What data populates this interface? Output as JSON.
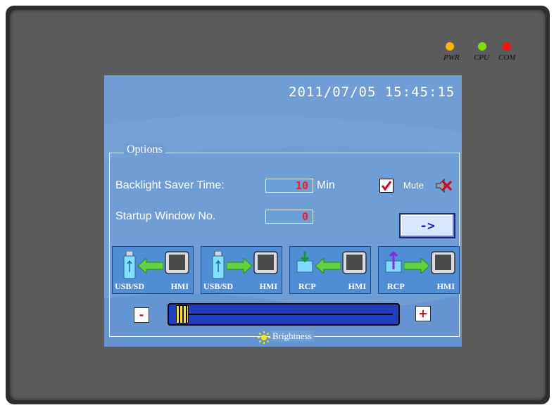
{
  "indicators": [
    {
      "label": "PWR",
      "color": "#ffb400"
    },
    {
      "label": "CPU",
      "color": "#7de000"
    },
    {
      "label": "COM",
      "color": "#ff1010"
    }
  ],
  "screen": {
    "datetime": "2011/07/05 15:45:15",
    "options_title": "Options",
    "backlight_label": "Backlight Saver Time:",
    "backlight_value": "10",
    "backlight_unit": "Min",
    "mute_label": "Mute",
    "mute_checked": true,
    "startup_label": "Startup Window No.",
    "startup_value": "0",
    "next_label": "->",
    "transfer_buttons": [
      {
        "left": "USB/SD",
        "right": "HMI",
        "direction": "to-left"
      },
      {
        "left": "USB/SD",
        "right": "HMI",
        "direction": "to-right"
      },
      {
        "left": "RCP",
        "right": "HMI",
        "direction": "to-left"
      },
      {
        "left": "RCP",
        "right": "HMI",
        "direction": "to-right"
      }
    ],
    "minus_label": "-",
    "plus_label": "+",
    "brightness_label": "Brightness",
    "brightness_level": 0.02
  },
  "colors": {
    "screen_bg": "#6f9ed6",
    "accent_red": "#ff1a1a",
    "slider_blue": "#1d3fc0",
    "arrow_green": "#5fd23c"
  }
}
